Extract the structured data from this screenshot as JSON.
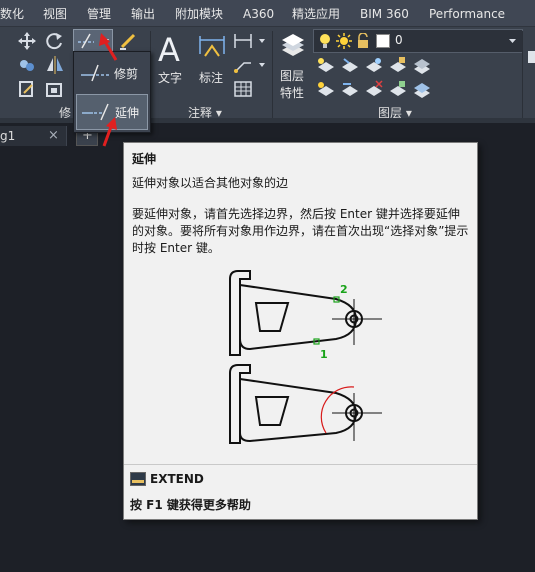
{
  "menubar": {
    "items": [
      "数化",
      "视图",
      "管理",
      "输出",
      "附加模块",
      "A360",
      "精选应用",
      "BIM 360",
      "Performance"
    ]
  },
  "ribbon": {
    "panels": {
      "modify": {
        "title": "修"
      },
      "annotation": {
        "title": "注释",
        "text_label": "文字",
        "dim_label": "标注"
      },
      "layers": {
        "title": "图层",
        "props_label_1": "图层",
        "props_label_2": "特性",
        "current_layer": "0"
      }
    }
  },
  "dropdown": {
    "items": [
      {
        "label": "修剪"
      },
      {
        "label": "延伸"
      }
    ]
  },
  "doc_tab": {
    "label": "g1",
    "close": "×",
    "add": "+"
  },
  "tooltip": {
    "title": "延伸",
    "description": "延伸对象以适合其他对象的边",
    "body": "要延伸对象，请首先选择边界，然后按 Enter 键并选择要延伸的对象。要将所有对象用作边界，请在首次出现“选择对象”提示时按 Enter 键。",
    "figure_labels": {
      "pick1": "1",
      "pick2": "2"
    },
    "command": "EXTEND",
    "help": "按 F1 键获得更多帮助"
  },
  "colors": {
    "arrow": "#e02020",
    "highlight_green": "#1aa31a",
    "extension_red": "#d81b1b"
  }
}
